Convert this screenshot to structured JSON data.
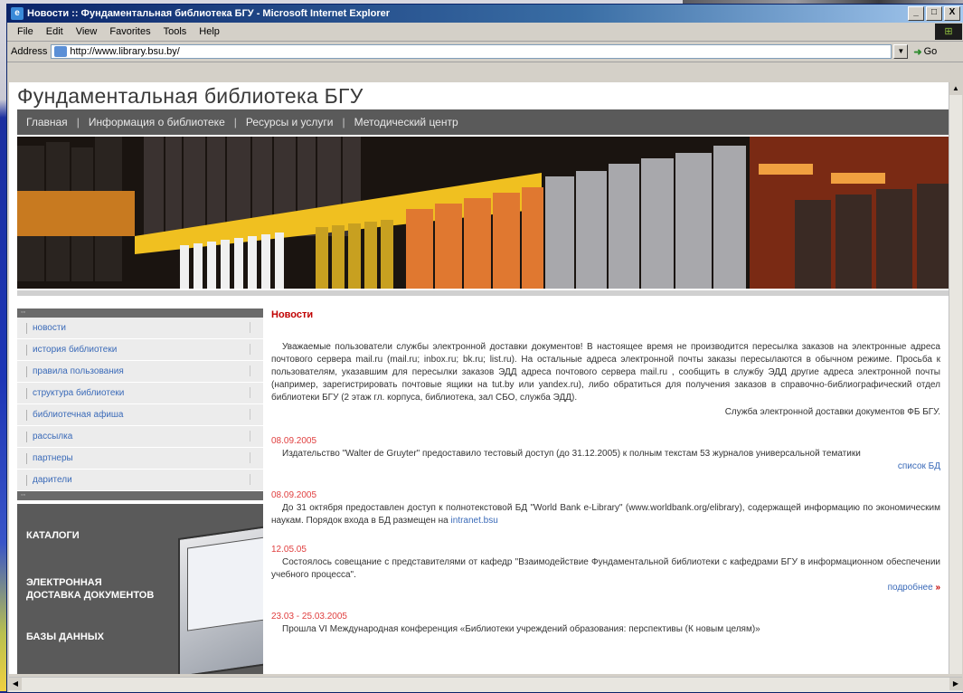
{
  "window": {
    "title": "Новости :: Фундаментальная библиотека БГУ - Microsoft Internet Explorer",
    "minimize": "_",
    "maximize": "□",
    "close": "X"
  },
  "menubar": {
    "items": [
      "File",
      "Edit",
      "View",
      "Favorites",
      "Tools",
      "Help"
    ]
  },
  "addressbar": {
    "label": "Address",
    "url": "http://www.library.bsu.by/",
    "go_label": "Go"
  },
  "site": {
    "title": "Фундаментальная библиотека БГУ",
    "nav": [
      "Главная",
      "Информация о библиотеке",
      "Ресурсы и услуги",
      "Методический центр"
    ],
    "nav_separator": "|"
  },
  "left_menu": {
    "items": [
      "новости",
      "история библиотеки",
      "правила пользования",
      "структура библиотеки",
      "библиотечная афиша",
      "рассылка",
      "партнеры",
      "дарители"
    ]
  },
  "promo": {
    "items": [
      "КАТАЛОГИ",
      "ЭЛЕКТРОННАЯ\nДОСТАВКА ДОКУМЕНТОВ",
      "БАЗЫ ДАННЫХ"
    ]
  },
  "news": {
    "heading": "Новости",
    "intro": "Уважаемые пользователи службы электронной доставки документов! В настоящее время не производится пересылка заказов на электронные адреса почтового сервера mail.ru (mail.ru; inbox.ru; bk.ru; list.ru). На остальные адреса электронной почты заказы пересылаются в обычном режиме. Просьба к пользователям, указавшим для пересылки заказов ЭДД адреса почтового сервера mail.ru , сообщить в службу ЭДД другие адреса электронной почты (например, зарегистрировать почтовые ящики на tut.by или yandex.ru), либо обратиться для получения заказов в справочно-библиографический отдел библиотеки БГУ (2 этаж гл. корпуса, библиотека, зал СБО, служба ЭДД).",
    "intro_signature": "Служба электронной доставки документов ФБ БГУ.",
    "items": [
      {
        "date": "08.09.2005",
        "text": "Издательство \"Walter de Gruyter\" предоставило тестовый доступ (до 31.12.2005) к полным текстам 53 журналов универсальной тематики",
        "link": "список БД"
      },
      {
        "date": "08.09.2005",
        "text": "До 31 октября предоставлен доступ к полнотекстовой БД \"World Bank e-Library\" (www.worldbank.org/elibrary), содержащей информацию по экономическим наукам. Порядок входа в БД размещен на",
        "inline_link": "intranet.bsu"
      },
      {
        "date": "12.05.05",
        "text": "Состоялось совещание с представителями от кафедр \"Взаимодействие Фундаментальной библиотеки с кафедрами БГУ в информационном обеспечении учебного процесса\".",
        "more": "подробнее",
        "more_arrow": "»"
      },
      {
        "date": "23.03 - 25.03.2005",
        "text": "Прошла VI Международная конференция «Библиотеки учреждений образования: перспективы (К новым целям)»"
      }
    ]
  },
  "colors": {
    "accent_red": "#c00000",
    "date_red": "#e04040",
    "link_blue": "#3a6ab8",
    "nav_bg": "#5a5a5a"
  }
}
